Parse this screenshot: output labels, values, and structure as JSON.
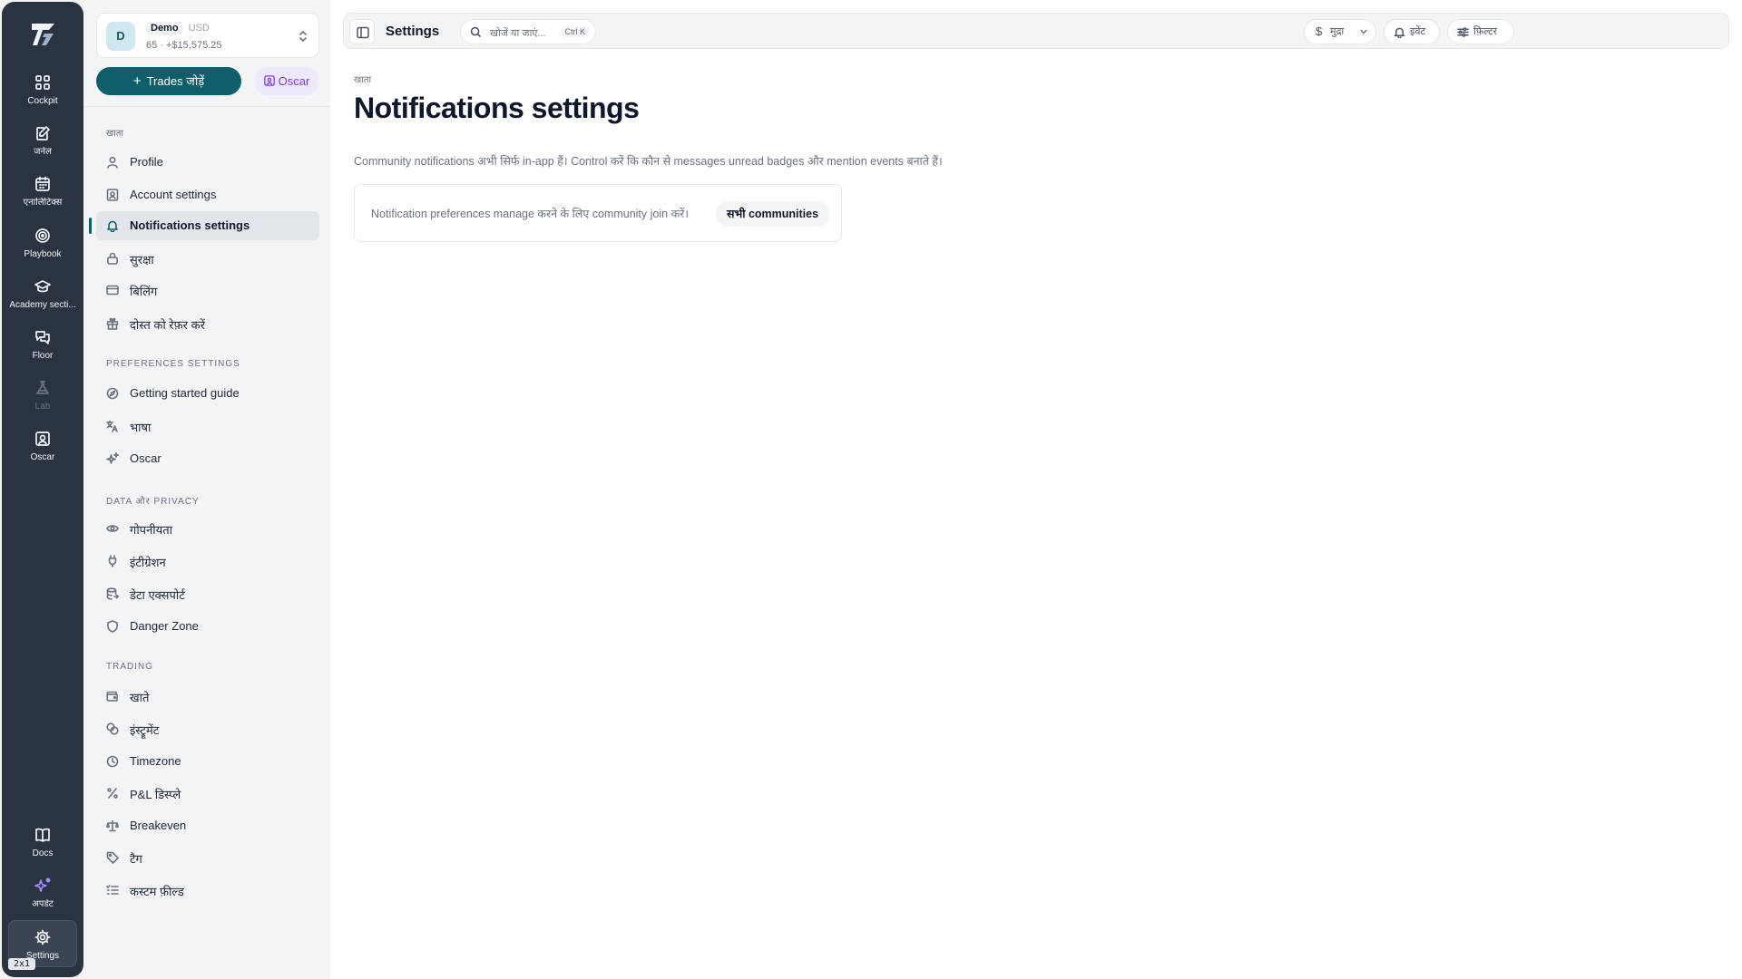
{
  "rail": {
    "items": [
      {
        "label": "Cockpit",
        "icon": "grid-icon"
      },
      {
        "label": "जर्नल",
        "icon": "journal-icon"
      },
      {
        "label": "एनालिटिक्स",
        "icon": "calendar-icon"
      },
      {
        "label": "Playbook",
        "icon": "target-icon"
      },
      {
        "label": "Academy secti...",
        "icon": "graduation-cap-icon"
      },
      {
        "label": "Floor",
        "icon": "chat-icon"
      },
      {
        "label": "Lab",
        "icon": "flask-icon"
      },
      {
        "label": "Oscar",
        "icon": "oscar-icon"
      }
    ],
    "bottom": [
      {
        "label": "Docs",
        "icon": "book-icon"
      },
      {
        "label": "अपडेट",
        "icon": "sparkles-icon"
      },
      {
        "label": "Settings",
        "icon": "gear-icon"
      }
    ],
    "badge": "2x1"
  },
  "account": {
    "initial": "D",
    "mode": "Demo",
    "currency": "USD",
    "summary": "65 · +$15,575.25"
  },
  "actions": {
    "add_trades": "Trades जोड़ें",
    "oscar": "Oscar"
  },
  "sidebar": {
    "sections": [
      {
        "label": "खाता",
        "items": [
          "Profile",
          "Account settings",
          "Notifications settings",
          "सुरक्षा",
          "बिलिंग",
          "दोस्त को रेफ़र करें"
        ]
      },
      {
        "label": "PREFERENCES SETTINGS",
        "items": [
          "Getting started guide",
          "भाषा",
          "Oscar"
        ]
      },
      {
        "label": "DATA और PRIVACY",
        "items": [
          "गोपनीयता",
          "इंटीग्रेशन",
          "डेटा एक्सपोर्ट",
          "Danger Zone"
        ]
      },
      {
        "label": "TRADING",
        "items": [
          "खाते",
          "इंस्ट्रूमेंट",
          "Timezone",
          "P&L डिस्प्ले",
          "Breakeven",
          "टैग",
          "कस्टम फ़ील्ड"
        ]
      }
    ],
    "active_item": "Notifications settings"
  },
  "topbar": {
    "title": "Settings",
    "search_placeholder": "खोजें या जाएं...",
    "search_shortcut": "Ctrl K",
    "currency_label": "मुद्रा",
    "events_label": "इवेंट",
    "filter_label": "फ़िल्टर"
  },
  "page": {
    "breadcrumb": "खाता",
    "title": "Notifications settings",
    "description": "Community notifications अभी सिर्फ in-app हैं। Control करें कि कौन से messages unread badges और mention events बनाते हैं।",
    "notice": "Notification preferences manage करने के लिए community join करें।",
    "notice_button": "सभी communities"
  },
  "colors": {
    "rail_bg": "#2a3441",
    "accent": "#0e5f6b",
    "oscar_purple": "#7c3aed"
  }
}
